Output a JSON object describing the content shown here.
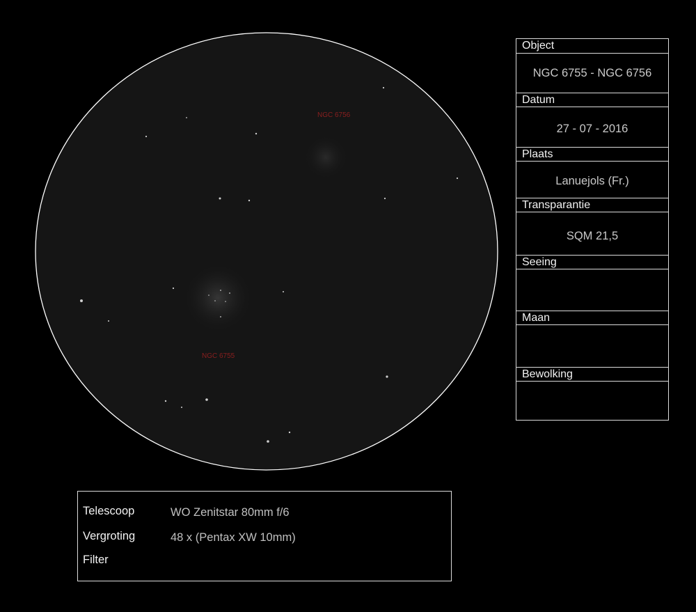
{
  "sketch": {
    "labels": [
      "NGC 6756",
      "NGC 6755"
    ]
  },
  "info": {
    "object_label": "Object",
    "object_value": "NGC 6755 - NGC 6756",
    "date_label": "Datum",
    "date_value": "27 - 07 - 2016",
    "place_label": "Plaats",
    "place_value": "Lanuejols (Fr.)",
    "transparency_label": "Transparantie",
    "transparency_value": "SQM 21,5",
    "seeing_label": "Seeing",
    "seeing_value": "",
    "moon_label": "Maan",
    "moon_value": "",
    "clouds_label": "Bewolking",
    "clouds_value": ""
  },
  "equipment": {
    "telescope_label": "Telescoop",
    "telescope_value": "WO Zenitstar 80mm f/6",
    "magnification_label": "Vergroting",
    "magnification_value": "48 x (Pentax XW 10mm)",
    "filter_label": "Filter",
    "filter_value": ""
  },
  "colors": {
    "background": "#000000",
    "field": "#151515",
    "outline": "#ffffff",
    "label": "#8a1f1f"
  }
}
